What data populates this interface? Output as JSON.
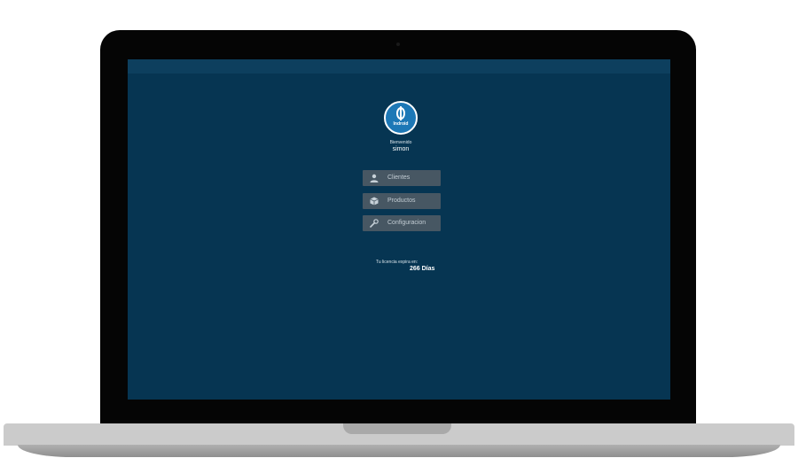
{
  "app": {
    "logo_text": "Indroid"
  },
  "welcome": {
    "greeting": "Bienvenido",
    "username": "simon"
  },
  "menu": {
    "items": [
      {
        "label": "Clientes",
        "icon": "user-icon"
      },
      {
        "label": "Productos",
        "icon": "box-icon"
      },
      {
        "label": "Configuracion",
        "icon": "wrench-icon"
      }
    ]
  },
  "license": {
    "label": "Tu licencia expira en:",
    "days": "266 Días"
  },
  "colors": {
    "screen_background": "#063552",
    "button_background": "#475763",
    "logo_accent": "#1d78b6"
  }
}
